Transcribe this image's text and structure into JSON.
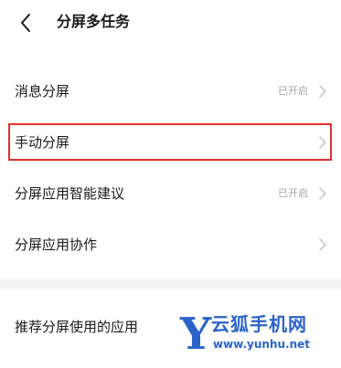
{
  "header": {
    "title": "分屏多任务"
  },
  "settings": [
    {
      "label": "消息分屏",
      "status": "已开启"
    },
    {
      "label": "手动分屏",
      "status": ""
    },
    {
      "label": "分屏应用智能建议",
      "status": "已开启"
    },
    {
      "label": "分屏应用协作",
      "status": ""
    },
    {
      "label": "推荐分屏使用的应用",
      "status": ""
    }
  ],
  "watermark": {
    "letter": "Y",
    "name": "云狐手机网",
    "url": "www.yunhu.net"
  },
  "colors": {
    "highlight": "#e0302e",
    "watermark": "#2a63c9",
    "status": "#a6a6a6"
  }
}
